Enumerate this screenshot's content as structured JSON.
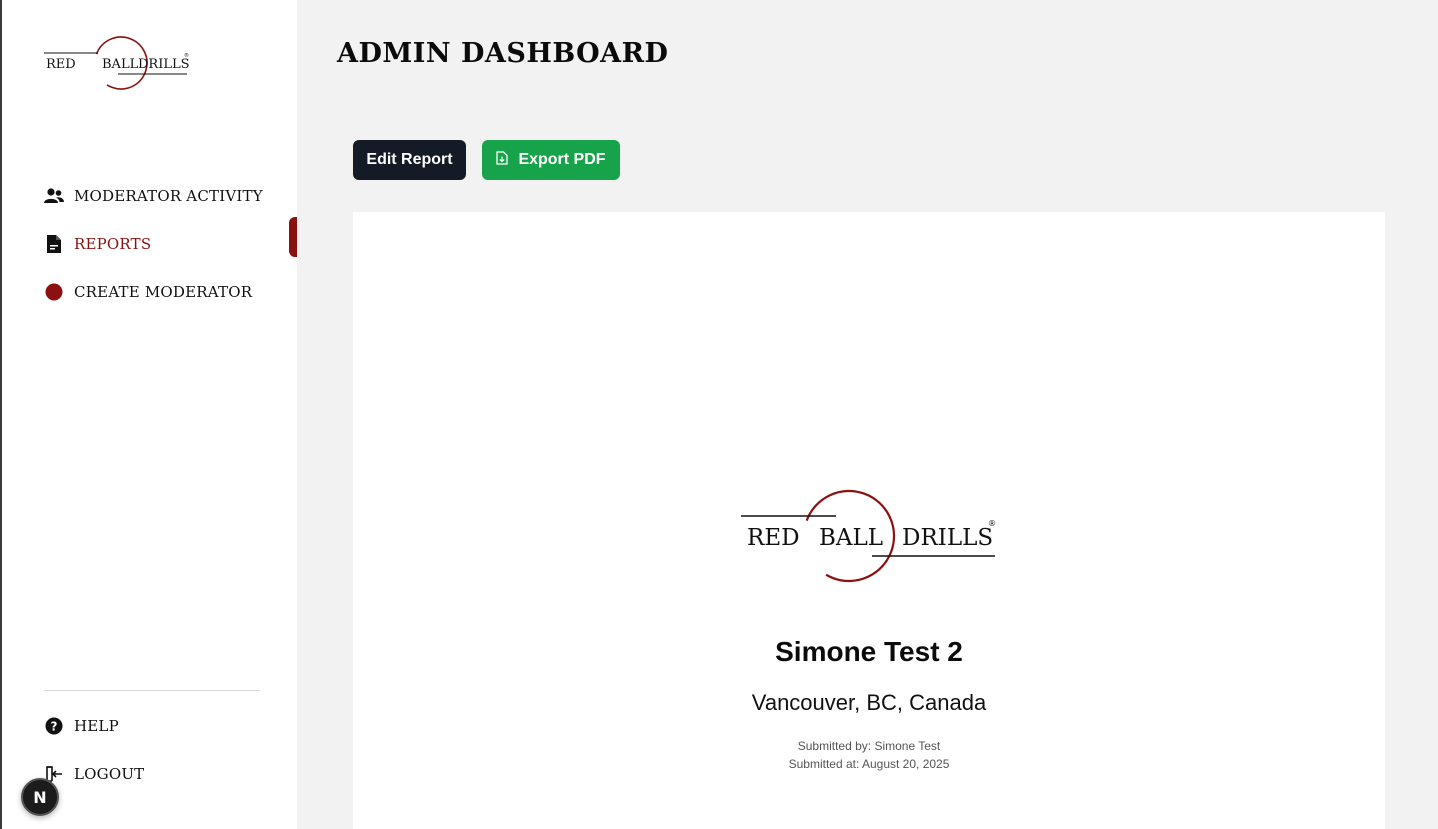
{
  "brand": {
    "logo_words": [
      "RED",
      "BALL",
      "DRILLS"
    ],
    "logo_mark": "®",
    "accent_color": "#8b1111"
  },
  "sidebar": {
    "items": [
      {
        "label": "MODERATOR ACTIVITY",
        "icon": "users-icon",
        "active": false
      },
      {
        "label": "REPORTS",
        "icon": "document-icon",
        "active": true
      },
      {
        "label": "CREATE MODERATOR",
        "icon": "red-dot-icon",
        "active": false
      }
    ],
    "bottom_items": [
      {
        "label": "HELP",
        "icon": "help-circle-icon"
      },
      {
        "label": "LOGOUT",
        "icon": "logout-icon"
      }
    ]
  },
  "dev_badge": {
    "label": "N"
  },
  "header": {
    "title": "ADMIN DASHBOARD"
  },
  "toolbar": {
    "edit_label": "Edit Report",
    "export_label": "Export PDF",
    "export_color": "#16a34a",
    "edit_color": "#141a26"
  },
  "report": {
    "name": "Simone Test 2",
    "location": "Vancouver, BC, Canada",
    "submitted_by": "Submitted by: Simone Test",
    "submitted_at": "Submitted at: August 20, 2025"
  }
}
